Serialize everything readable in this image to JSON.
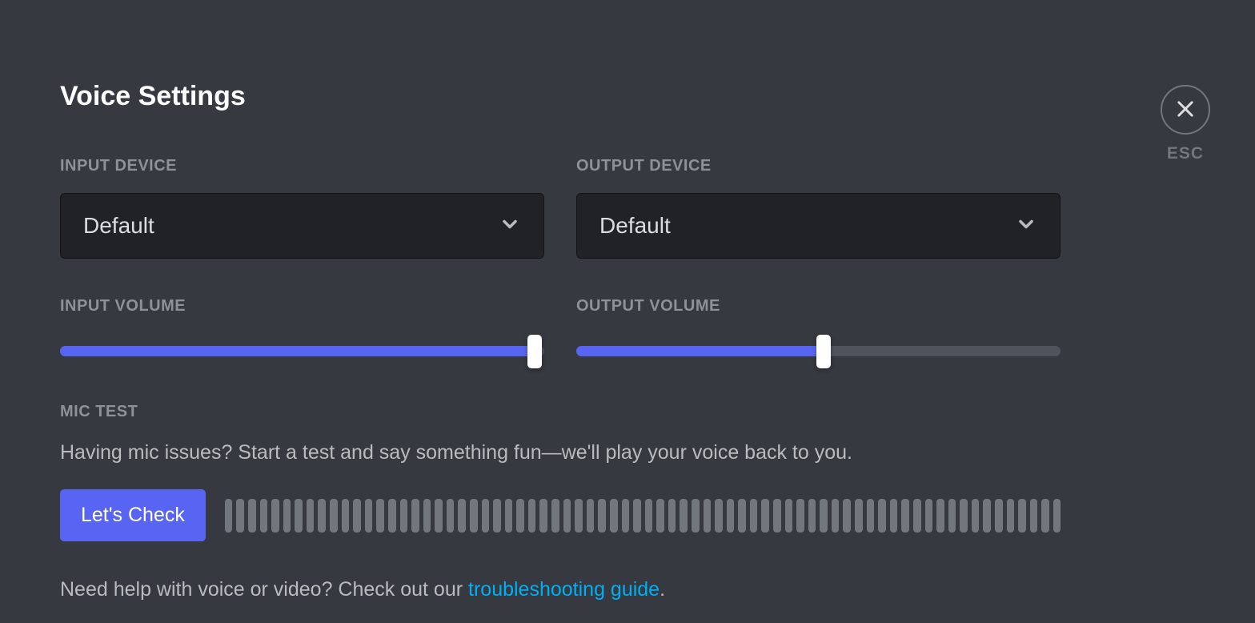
{
  "page": {
    "title": "Voice Settings",
    "escLabel": "ESC"
  },
  "inputDevice": {
    "label": "INPUT DEVICE",
    "value": "Default"
  },
  "outputDevice": {
    "label": "OUTPUT DEVICE",
    "value": "Default"
  },
  "inputVolume": {
    "label": "INPUT VOLUME",
    "percent": 98
  },
  "outputVolume": {
    "label": "OUTPUT VOLUME",
    "percent": 51
  },
  "micTest": {
    "label": "MIC TEST",
    "description": "Having mic issues? Start a test and say something fun—we'll play your voice back to you.",
    "buttonLabel": "Let's Check",
    "barCount": 72
  },
  "help": {
    "prefix": "Need help with voice or video? Check out our ",
    "linkText": "troubleshooting guide",
    "suffix": "."
  }
}
